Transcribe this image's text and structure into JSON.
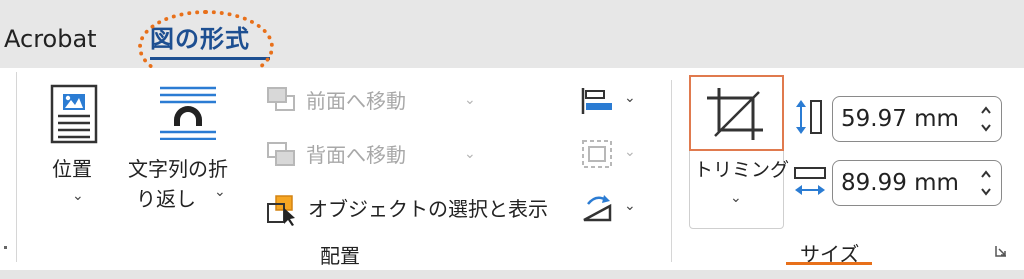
{
  "tabs": {
    "acrobat": "Acrobat",
    "active": "図の形式"
  },
  "position": {
    "label": "位置"
  },
  "wrap": {
    "label_line1": "文字列の折",
    "label_line2": "り返し"
  },
  "arrange": {
    "bring_forward": "前面へ移動",
    "send_backward": "背面へ移動",
    "selection_pane": "オブジェクトの選択と表示",
    "group_label": "配置"
  },
  "size": {
    "crop_label": "トリミング",
    "height_value": "59.97 mm",
    "width_value": "89.99 mm",
    "group_label": "サイズ"
  },
  "colors": {
    "accent": "#e8701a",
    "active_tab": "#1d4f91",
    "icon_blue": "#2b7cd3"
  }
}
